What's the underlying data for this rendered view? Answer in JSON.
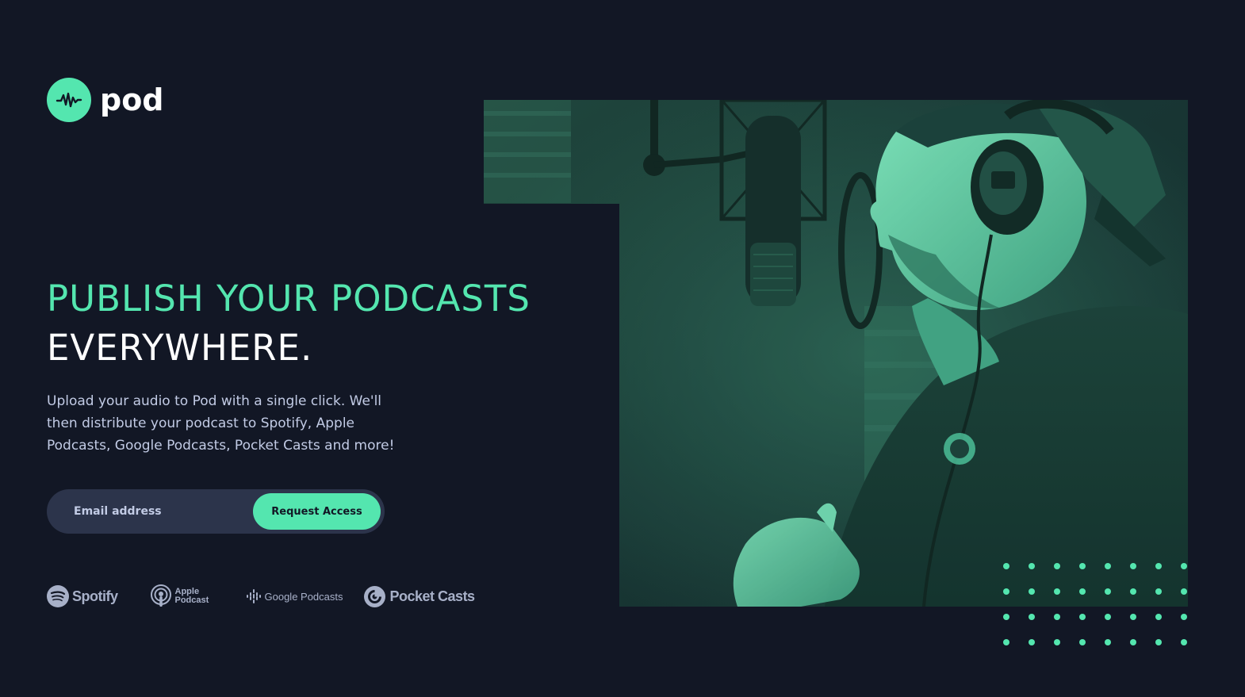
{
  "brand": {
    "name": "pod",
    "accent_color": "#54E6AF",
    "background_color": "#121725",
    "logo_icon": "waveform-icon"
  },
  "hero": {
    "headline_line1": "PUBLISH YOUR PODCASTS",
    "headline_line2": "EVERYWHERE.",
    "description": "Upload your audio to Pod with a single click. We'll then distribute your podcast to Spotify, Apple Podcasts, Google Podcasts, Pocket Casts and more!",
    "photo": "podcaster-at-microphone-image"
  },
  "signup": {
    "email_placeholder": "Email address",
    "email_value": "",
    "button_label": "Request Access"
  },
  "platforms": [
    {
      "name": "Spotify",
      "icon": "spotify-icon"
    },
    {
      "name": "Apple Podcast",
      "line1": "Apple",
      "line2": "Podcast",
      "icon": "apple-podcast-icon"
    },
    {
      "name": "Google Podcasts",
      "icon": "google-podcasts-icon"
    },
    {
      "name": "Pocket Casts",
      "icon": "pocket-casts-icon"
    }
  ],
  "decoration": {
    "dot_pattern": "dot-grid"
  }
}
